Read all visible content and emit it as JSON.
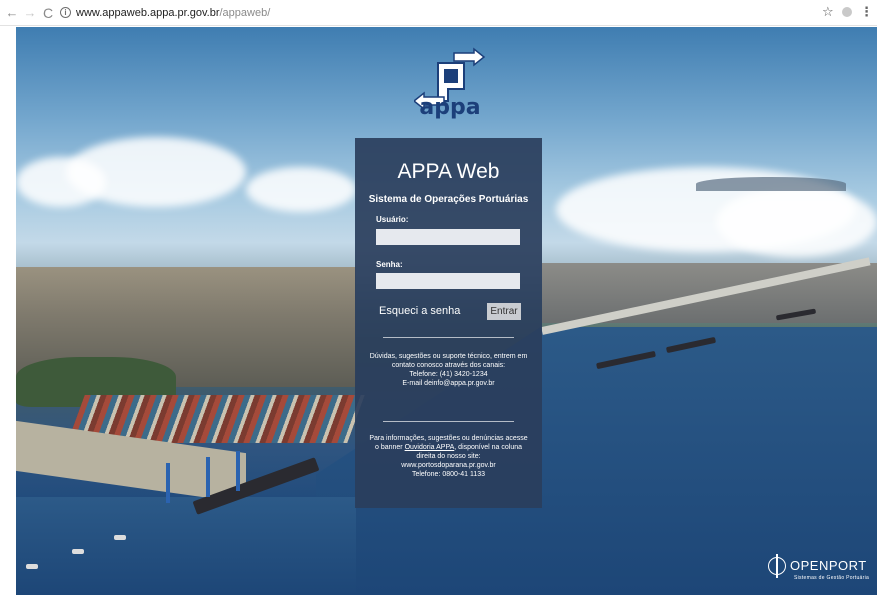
{
  "browser": {
    "back_glyph": "←",
    "forward_glyph": "→",
    "reload_glyph": "C",
    "info_glyph": "i",
    "url_host": "www.appaweb.appa.pr.gov.br",
    "url_path": "/appaweb/",
    "star_glyph": "☆",
    "menu_glyph": "⋮"
  },
  "logo": {
    "text": "appa",
    "color": "#1c3f7a"
  },
  "login": {
    "title": "APPA Web",
    "subtitle": "Sistema de Operações Portuárias",
    "user_label": "Usuário:",
    "user_value": "",
    "password_label": "Senha:",
    "password_value": "",
    "forgot_label": "Esqueci a senha",
    "submit_label": "Entrar",
    "panel_color": "#2a3e5c"
  },
  "support": {
    "line1": "Dúvidas, sugestões ou suporte técnico, entrem em contato conosco através dos canais:",
    "phone": "Telefone: (41) 3420-1234",
    "email": "E-mail deinfo@appa.pr.gov.br"
  },
  "ombudsman": {
    "text_before": "Para informações, sugestões ou denúncias acesse o banner ",
    "link": "Ouvidoria APPA",
    "text_after": ", disponível na coluna direita do nosso site:",
    "site": "www.portosdoparana.pr.gov.br",
    "phone": "Telefone: 0800-41 1133"
  },
  "brand": {
    "name": "OPENPORT",
    "tagline": "Sistemas de Gestão Portuária"
  }
}
